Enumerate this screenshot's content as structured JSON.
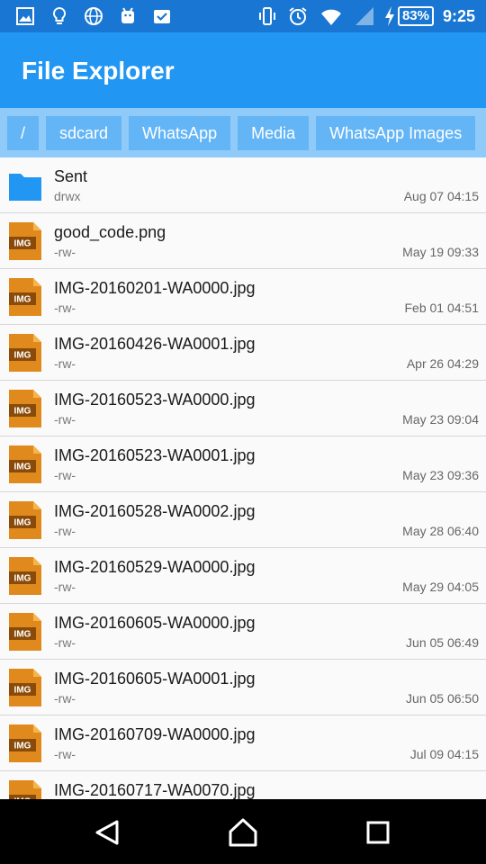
{
  "status_bar": {
    "time": "9:25",
    "battery_percent": "83%",
    "icons_left": [
      "image-icon",
      "bulb-icon",
      "globe-icon",
      "android-icon",
      "tasks-icon"
    ],
    "icons_right": [
      "vibrate-icon",
      "alarm-icon",
      "wifi-icon",
      "signal-icon",
      "charging-icon"
    ]
  },
  "app_bar": {
    "title": "File Explorer"
  },
  "breadcrumb": [
    "/",
    "sdcard",
    "WhatsApp",
    "Media",
    "WhatsApp Images"
  ],
  "files": [
    {
      "name": "Sent",
      "perms": "drwx",
      "date": "Aug 07 04:15",
      "type": "folder"
    },
    {
      "name": "good_code.png",
      "perms": "-rw-",
      "date": "May 19 09:33",
      "type": "image"
    },
    {
      "name": "IMG-20160201-WA0000.jpg",
      "perms": "-rw-",
      "date": "Feb 01 04:51",
      "type": "image"
    },
    {
      "name": "IMG-20160426-WA0001.jpg",
      "perms": "-rw-",
      "date": "Apr 26 04:29",
      "type": "image"
    },
    {
      "name": "IMG-20160523-WA0000.jpg",
      "perms": "-rw-",
      "date": "May 23 09:04",
      "type": "image"
    },
    {
      "name": "IMG-20160523-WA0001.jpg",
      "perms": "-rw-",
      "date": "May 23 09:36",
      "type": "image"
    },
    {
      "name": "IMG-20160528-WA0002.jpg",
      "perms": "-rw-",
      "date": "May 28 06:40",
      "type": "image"
    },
    {
      "name": "IMG-20160529-WA0000.jpg",
      "perms": "-rw-",
      "date": "May 29 04:05",
      "type": "image"
    },
    {
      "name": "IMG-20160605-WA0000.jpg",
      "perms": "-rw-",
      "date": "Jun 05 06:49",
      "type": "image"
    },
    {
      "name": "IMG-20160605-WA0001.jpg",
      "perms": "-rw-",
      "date": "Jun 05 06:50",
      "type": "image"
    },
    {
      "name": "IMG-20160709-WA0000.jpg",
      "perms": "-rw-",
      "date": "Jul 09 04:15",
      "type": "image"
    },
    {
      "name": "IMG-20160717-WA0070.jpg",
      "perms": "",
      "date": "",
      "type": "image"
    }
  ],
  "file_icon_label": "IMG",
  "colors": {
    "status_bar": "#1976d2",
    "app_bar": "#2196f3",
    "breadcrumb_bg": "#90caf9",
    "crumb_bg": "#64b5f6",
    "folder": "#2196f3",
    "image_icon": "#e08a1e"
  },
  "nav_bar": {
    "buttons": [
      "back-icon",
      "home-icon",
      "recents-icon"
    ]
  }
}
